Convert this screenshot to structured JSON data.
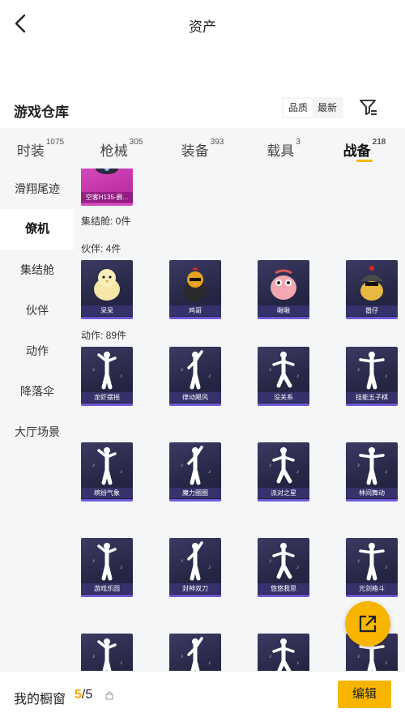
{
  "header": {
    "title": "资产"
  },
  "warehouse": {
    "title": "游戏仓库",
    "sort_quality": "品质",
    "sort_latest": "最新"
  },
  "tabs": [
    {
      "label": "时装",
      "count": "1075"
    },
    {
      "label": "枪械",
      "count": "305"
    },
    {
      "label": "装备",
      "count": "393"
    },
    {
      "label": "载具",
      "count": "3"
    },
    {
      "label": "战备",
      "count": "218"
    }
  ],
  "sidebar": [
    "滑翔尾迹",
    "僚机",
    "集结舱",
    "伙伴",
    "动作",
    "降落伞",
    "大厅场景"
  ],
  "sections": {
    "partial_item": "空客H135-爵...",
    "assembly": "集结舱: 0件",
    "partner": "伙伴: 4件",
    "action": "动作: 89件"
  },
  "partners": [
    "呆呆",
    "鸡哥",
    "啾啾",
    "嚣仔"
  ],
  "actions": [
    "龙虾摆摇",
    "律动飓风",
    "没关系",
    "技能五子棋",
    "缤纷气象",
    "魔力圈圈",
    "派对之星",
    "林间舞动",
    "游戏乐园",
    "封神双刀",
    "悠悠我思",
    "光剑格斗",
    "",
    "",
    "",
    ""
  ],
  "bottom": {
    "label": "我的橱窗",
    "count_used": "5",
    "count_total": "/5",
    "edit": "编辑"
  },
  "colors": {
    "accent": "#f7b500",
    "card": "#2b2b4d"
  }
}
